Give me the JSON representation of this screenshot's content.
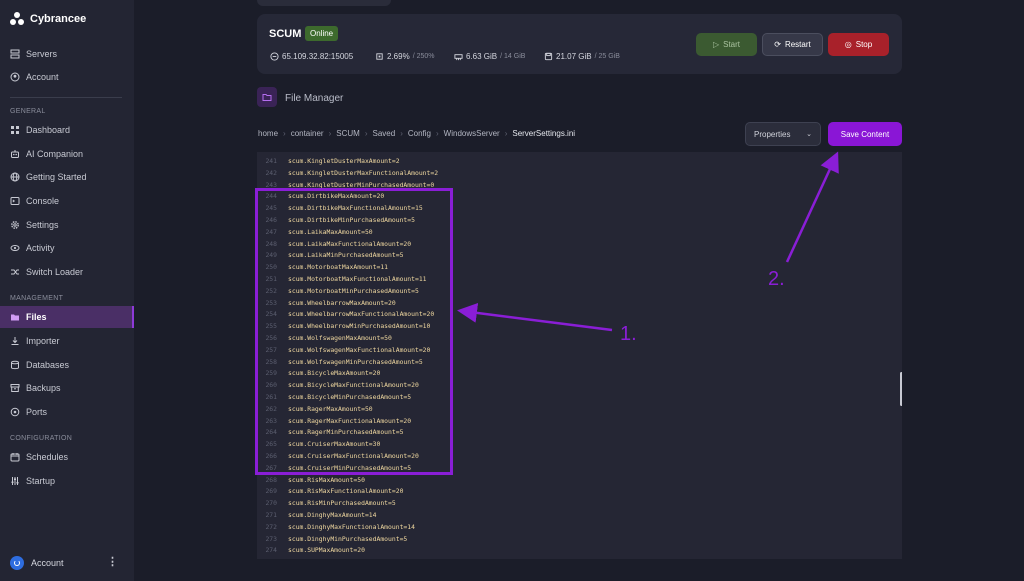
{
  "sidebar": {
    "brand": "Cybrancee",
    "top_items": [
      "Servers",
      "Account"
    ],
    "general_label": "GENERAL",
    "general_items": [
      "Dashboard",
      "AI Companion",
      "Getting Started",
      "Console",
      "Settings",
      "Activity",
      "Switch Loader"
    ],
    "management_label": "MANAGEMENT",
    "management_items": [
      "Files",
      "Importer",
      "Databases",
      "Backups",
      "Ports"
    ],
    "configuration_label": "CONFIGURATION",
    "configuration_items": [
      "Schedules",
      "Startup"
    ],
    "footer_account": "Account",
    "active_item": "Files"
  },
  "server": {
    "name": "SCUM",
    "status": "Online",
    "address": "65.109.32.82:15005",
    "cpu": "2.69%",
    "cpu_limit": "/ 250%",
    "memory": "6.63 GiB",
    "memory_limit": "/ 14 GiB",
    "disk": "21.07 GiB",
    "disk_limit": "/ 25 GiB",
    "start_label": "Start",
    "restart_label": "Restart",
    "stop_label": "Stop"
  },
  "file_manager": {
    "title": "File Manager",
    "breadcrumb": [
      "home",
      "container",
      "SCUM",
      "Saved",
      "Config",
      "WindowsServer",
      "ServerSettings.ini"
    ],
    "properties_label": "Properties",
    "save_label": "Save Content"
  },
  "editor": {
    "lines": [
      {
        "n": "241",
        "t": "scum.KingletDusterMaxAmount=2"
      },
      {
        "n": "242",
        "t": "scum.KingletDusterMaxFunctionalAmount=2"
      },
      {
        "n": "243",
        "t": "scum.KingletDusterMinPurchasedAmount=0"
      },
      {
        "n": "244",
        "t": "scum.DirtbikeMaxAmount=20"
      },
      {
        "n": "245",
        "t": "scum.DirtbikeMaxFunctionalAmount=15"
      },
      {
        "n": "246",
        "t": "scum.DirtbikeMinPurchasedAmount=5"
      },
      {
        "n": "247",
        "t": "scum.LaikaMaxAmount=50"
      },
      {
        "n": "248",
        "t": "scum.LaikaMaxFunctionalAmount=20"
      },
      {
        "n": "249",
        "t": "scum.LaikaMinPurchasedAmount=5"
      },
      {
        "n": "250",
        "t": "scum.MotorboatMaxAmount=11"
      },
      {
        "n": "251",
        "t": "scum.MotorboatMaxFunctionalAmount=11"
      },
      {
        "n": "252",
        "t": "scum.MotorboatMinPurchasedAmount=5"
      },
      {
        "n": "253",
        "t": "scum.WheelbarrowMaxAmount=20"
      },
      {
        "n": "254",
        "t": "scum.WheelbarrowMaxFunctionalAmount=20"
      },
      {
        "n": "255",
        "t": "scum.WheelbarrowMinPurchasedAmount=10"
      },
      {
        "n": "256",
        "t": "scum.WolfswagenMaxAmount=50"
      },
      {
        "n": "257",
        "t": "scum.WolfswagenMaxFunctionalAmount=20"
      },
      {
        "n": "258",
        "t": "scum.WolfswagenMinPurchasedAmount=5"
      },
      {
        "n": "259",
        "t": "scum.BicycleMaxAmount=20"
      },
      {
        "n": "260",
        "t": "scum.BicycleMaxFunctionalAmount=20"
      },
      {
        "n": "261",
        "t": "scum.BicycleMinPurchasedAmount=5"
      },
      {
        "n": "262",
        "t": "scum.RagerMaxAmount=50"
      },
      {
        "n": "263",
        "t": "scum.RagerMaxFunctionalAmount=20"
      },
      {
        "n": "264",
        "t": "scum.RagerMinPurchasedAmount=5"
      },
      {
        "n": "265",
        "t": "scum.CruiserMaxAmount=30"
      },
      {
        "n": "266",
        "t": "scum.CruiserMaxFunctionalAmount=20"
      },
      {
        "n": "267",
        "t": "scum.CruiserMinPurchasedAmount=5"
      },
      {
        "n": "268",
        "t": "scum.RisMaxAmount=50"
      },
      {
        "n": "269",
        "t": "scum.RisMaxFunctionalAmount=20"
      },
      {
        "n": "270",
        "t": "scum.RisMinPurchasedAmount=5"
      },
      {
        "n": "271",
        "t": "scum.DinghyMaxAmount=14"
      },
      {
        "n": "272",
        "t": "scum.DinghyMaxFunctionalAmount=14"
      },
      {
        "n": "273",
        "t": "scum.DinghyMinPurchasedAmount=5"
      },
      {
        "n": "274",
        "t": "scum.SUPMaxAmount=20"
      }
    ]
  },
  "annotations": {
    "label_1": "1.",
    "label_2": "2.",
    "color": "#8a1ed6"
  }
}
